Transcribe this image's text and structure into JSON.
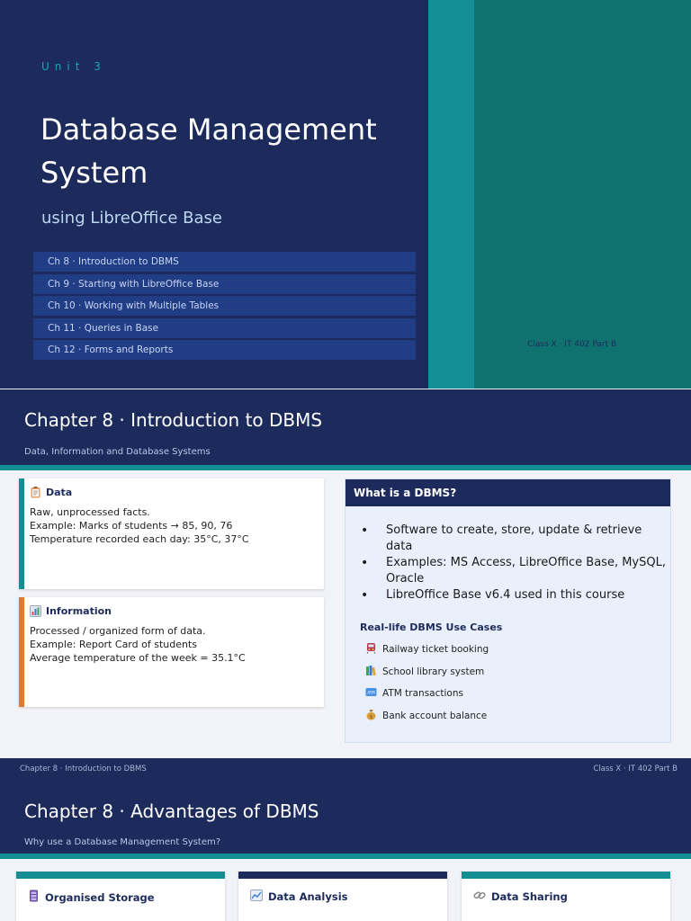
{
  "title_slide": {
    "unit": "Unit 3",
    "title": "Database Management System",
    "subtitle": "using LibreOffice Base",
    "chapters": [
      "Ch 8 · Introduction to DBMS",
      "Ch 9 · Starting with LibreOffice Base",
      "Ch 10 · Working with Multiple Tables",
      "Ch 11 · Queries in Base",
      "Ch 12 · Forms and Reports"
    ],
    "class_label": "Class X · IT 402 Part B"
  },
  "intro_slide": {
    "title": "Chapter 8 · Introduction to DBMS",
    "subtitle": "Data, Information and Database Systems",
    "data_card": {
      "heading": "Data",
      "lines": [
        "Raw, unprocessed facts.",
        "Example: Marks of students → 85, 90, 76",
        "Temperature recorded each day: 35°C, 37°C"
      ]
    },
    "info_card": {
      "heading": "Information",
      "lines": [
        "Processed / organized form of data.",
        "Example: Report Card of students",
        "Average temperature of the week = 35.1°C"
      ]
    },
    "dbms_box": {
      "heading": "What is a DBMS?",
      "bullets": [
        "Software to create, store, update & retrieve data",
        "Examples: MS Access, LibreOffice Base, MySQL, Oracle",
        "LibreOffice Base v6.4 used in this course"
      ],
      "use_cases_title": "Real-life DBMS Use Cases",
      "use_cases": [
        {
          "label": "Railway ticket booking",
          "icon": "train-icon"
        },
        {
          "label": "School library system",
          "icon": "books-icon"
        },
        {
          "label": "ATM transactions",
          "icon": "atm-icon"
        },
        {
          "label": "Bank account balance",
          "icon": "money-bag-icon"
        }
      ]
    },
    "footer_left": "Chapter 8 · Introduction to DBMS",
    "footer_right": "Class X · IT 402 Part B"
  },
  "advantages_slide": {
    "title": "Chapter 8 · Advantages of DBMS",
    "subtitle": "Why use a Database Management System?",
    "cards": [
      {
        "heading": "Organised Storage",
        "icon": "storage-icon",
        "accent": "#138e93"
      },
      {
        "heading": "Data Analysis",
        "icon": "chart-icon",
        "accent": "#1d2b5c"
      },
      {
        "heading": "Data Sharing",
        "icon": "link-icon",
        "accent": "#138e93"
      }
    ]
  },
  "colors": {
    "navy": "#1d2b5c",
    "teal": "#138e93",
    "orange": "#e07b2e",
    "list_item": "#213d86"
  }
}
